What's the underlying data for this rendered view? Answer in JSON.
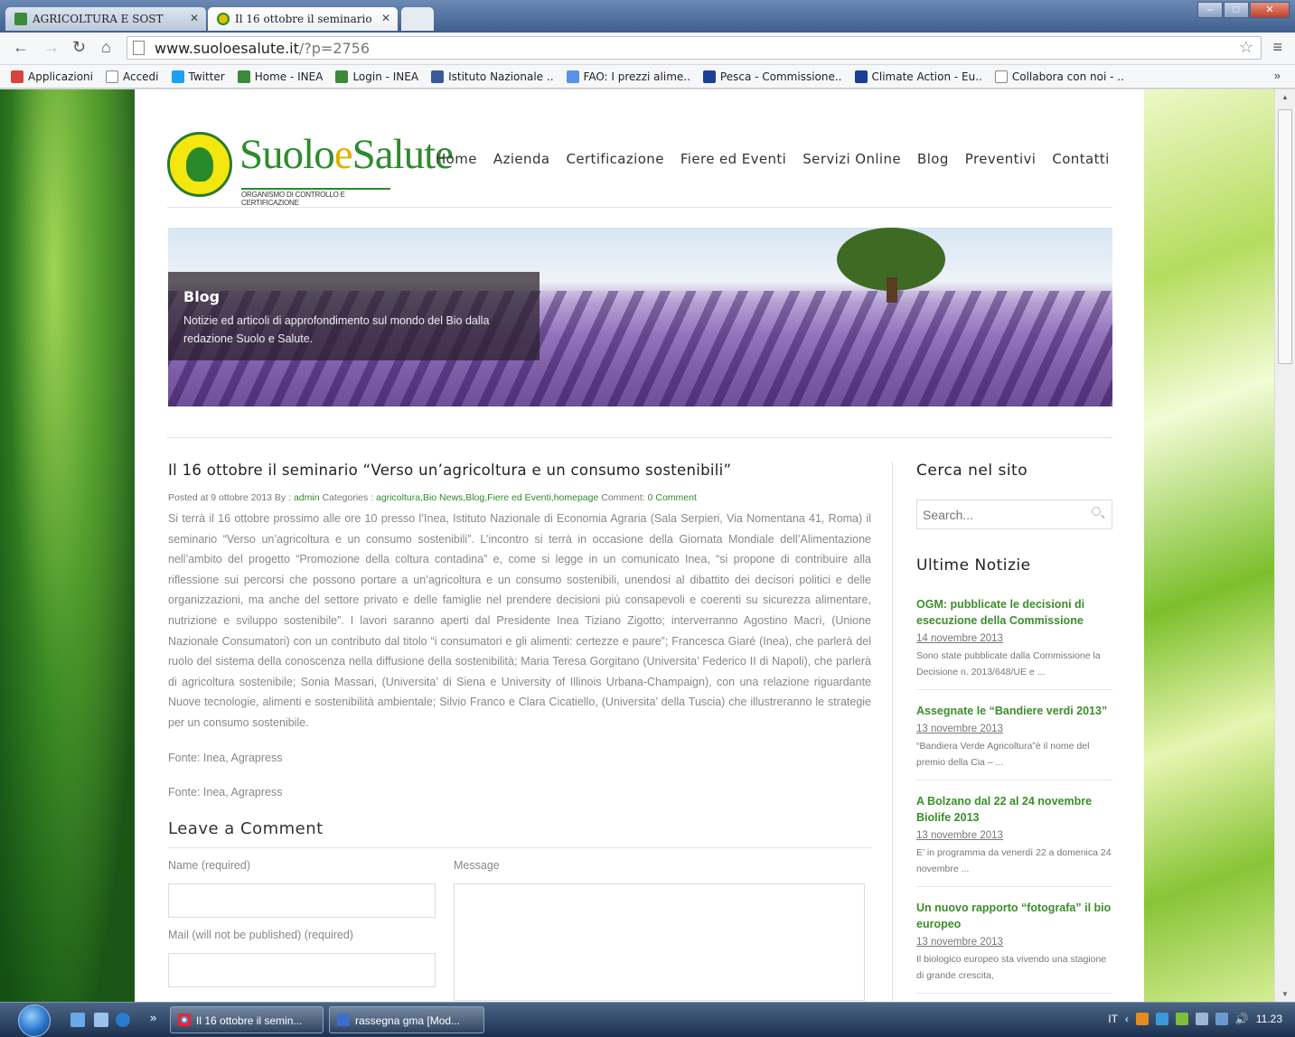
{
  "browser": {
    "tabs": [
      {
        "title": "AGRICOLTURA E SOST",
        "active": false
      },
      {
        "title": "Il 16 ottobre il seminario",
        "active": true
      }
    ],
    "url_host": "www.suoloesalute.it",
    "url_path": "/?p=2756",
    "bookmarks": [
      {
        "label": "Applicazioni",
        "icon": "apps-grid-icon",
        "color": "#d6453d"
      },
      {
        "label": "Accedi",
        "icon": "page-icon",
        "color": "#ffffff"
      },
      {
        "label": "Twitter",
        "icon": "twitter-icon",
        "color": "#1da1f2"
      },
      {
        "label": "Home - INEA",
        "icon": "inea-icon",
        "color": "#3a8a3a"
      },
      {
        "label": "Login - INEA",
        "icon": "inea-icon",
        "color": "#3a8a3a"
      },
      {
        "label": "Istituto Nazionale ..",
        "icon": "facebook-icon",
        "color": "#3b5998"
      },
      {
        "label": "FAO: I prezzi alime..",
        "icon": "fao-icon",
        "color": "#5b92e5"
      },
      {
        "label": "Pesca - Commissione..",
        "icon": "eu-icon",
        "color": "#1b3f94"
      },
      {
        "label": "Climate Action - Eu..",
        "icon": "eu-icon",
        "color": "#1b3f94"
      },
      {
        "label": "Collabora con noi - ..",
        "icon": "page-icon",
        "color": "#ffffff"
      }
    ],
    "bookmarks_more": "»"
  },
  "site": {
    "logo_text_a": "Suolo",
    "logo_text_e": "e",
    "logo_text_b": "Salute",
    "logo_tagline": "ORGANISMO DI CONTROLLO E CERTIFICAZIONE",
    "nav": [
      "Home",
      "Azienda",
      "Certificazione",
      "Fiere ed Eventi",
      "Servizi Online",
      "Blog",
      "Preventivi",
      "Contatti"
    ],
    "banner": {
      "title": "Blog",
      "subtitle": "Notizie ed articoli di approfondimento sul mondo del Bio dalla redazione Suolo e Salute."
    }
  },
  "article": {
    "title": "Il 16 ottobre il seminario “Verso un’agricoltura e un consumo sostenibili”",
    "meta_prefix": "Posted at 9 ottobre 2013 By :",
    "meta_author": "admin",
    "meta_cat_label": "Categories :",
    "meta_categories": "agricoltura,Bio News,Blog,Fiere ed Eventi,homepage",
    "meta_comment_label": "Comment:",
    "meta_comment_count": "0 Comment",
    "body": "Si terrà il 16 ottobre prossimo alle ore 10 presso l’Inea, Istituto Nazionale di Economia Agraria (Sala Serpieri, Via Nomentana 41, Roma) il seminario “Verso un’agricoltura e un consumo sostenibili”. L’incontro si terrà in occasione della Giornata Mondiale dell’Alimentazione nell’ambito del progetto “Promozione della coltura contadina” e, come si legge in un comunicato Inea, “si propone di contribuire alla riflessione sui percorsi che possono portare a un’agricoltura e un consumo sostenibili, unendosi al dibattito dei decisori politici e delle organizzazioni, ma anche del settore privato e delle famiglie nel prendere decisioni più consapevoli e coerenti su sicurezza alimentare, nutrizione e sviluppo sostenibile”. I lavori saranno aperti dal Presidente Inea Tiziano Zigotto; interverranno Agostino Macrì, (Unione Nazionale Consumatori) con un contributo dal titolo “i consumatori e gli alimenti: certezze e paure”;  Francesca Giaré (Inea), che parlerà del ruolo del sistema della conoscenza nella diffusione della sostenibilità; Maria Teresa Gorgitano (Universita’ Federico II di Napoli), che parlerà di agricoltura sostenibile; Sonia Massari, (Universita’ di Siena e University of Illinois Urbana-Champaign), con una relazione riguardante Nuove tecnologie, alimenti e sostenibilità ambientale; Silvio Franco  e Clara Cicatiello, (Universita’ della Tuscia) che illustreranno le strategie per un consumo sostenibile.",
    "source1": "Fonte: Inea, Agrapress",
    "source2": "Fonte: Inea, Agrapress"
  },
  "comment_form": {
    "heading": "Leave a Comment",
    "name_label": "Name (required)",
    "mail_label": "Mail (will not be published) (required)",
    "message_label": "Message"
  },
  "sidebar": {
    "search_heading": "Cerca nel sito",
    "search_placeholder": "Search...",
    "news_heading": "Ultime Notizie",
    "news": [
      {
        "title": "OGM: pubblicate le decisioni di esecuzione della Commissione",
        "date": "14 novembre 2013",
        "excerpt": "Sono state pubblicate dalla Commissione la Decisione n. 2013/648/UE e ..."
      },
      {
        "title": "Assegnate le “Bandiere verdi 2013”",
        "date": "13 novembre 2013",
        "excerpt": "“Bandiera Verde Agricoltura”è il nome del premio della Cia – ..."
      },
      {
        "title": "A Bolzano dal 22 al 24 novembre Biolife 2013",
        "date": "13 novembre 2013",
        "excerpt": "E’ in programma da venerdì 22 a domenica 24 novembre ..."
      },
      {
        "title": "Un nuovo rapporto “fotografa” il bio europeo",
        "date": "13 novembre 2013",
        "excerpt": "Il biologico europeo sta vivendo una stagione di grande crescita,"
      }
    ]
  },
  "taskbar": {
    "buttons": [
      "Il 16 ottobre il semin...",
      "rassegna gma [Mod..."
    ],
    "chevron": "»",
    "lang": "IT",
    "clock": "11.23"
  }
}
